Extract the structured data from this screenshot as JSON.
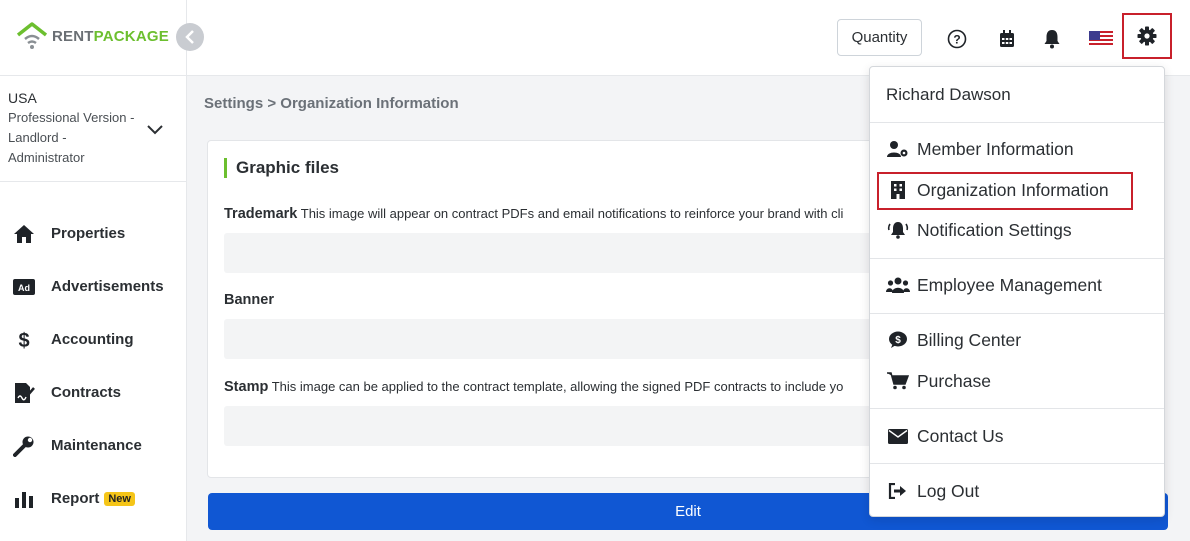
{
  "brand": {
    "name_part1": "RENT",
    "name_part2": "PACKAGE",
    "accent": "#6cbf2f"
  },
  "account": {
    "country": "USA",
    "role": "Professional Version - Landlord - Administrator"
  },
  "nav": [
    {
      "label": "Properties",
      "icon": "home-icon"
    },
    {
      "label": "Advertisements",
      "icon": "ad-icon"
    },
    {
      "label": "Accounting",
      "icon": "dollar-icon"
    },
    {
      "label": "Contracts",
      "icon": "contract-icon"
    },
    {
      "label": "Maintenance",
      "icon": "wrench-icon"
    },
    {
      "label": "Report",
      "icon": "bar-chart-icon",
      "badge": "New"
    }
  ],
  "header": {
    "quantity_label": "Quantity"
  },
  "breadcrumb": {
    "root": "Settings",
    "separator": ">",
    "current": "Organization Information"
  },
  "card": {
    "title": "Graphic files",
    "fields": [
      {
        "label": "Trademark",
        "description": "This image will appear on contract PDFs and email notifications to reinforce your brand with cli"
      },
      {
        "label": "Banner",
        "description": ""
      },
      {
        "label": "Stamp",
        "description": "This image can be applied to the contract template, allowing the signed PDF contracts to include yo"
      }
    ]
  },
  "edit_label": "Edit",
  "dropdown": {
    "user_name": "Richard Dawson",
    "items": [
      {
        "label": "Member Information",
        "icon": "user-gear-icon"
      },
      {
        "label": "Organization Information",
        "icon": "building-icon"
      },
      {
        "label": "Notification Settings",
        "icon": "bell-ring-icon"
      },
      {
        "label": "Employee Management",
        "icon": "users-icon"
      },
      {
        "label": "Billing Center",
        "icon": "dollar-bubble-icon"
      },
      {
        "label": "Purchase",
        "icon": "cart-icon"
      },
      {
        "label": "Contact Us",
        "icon": "envelope-icon"
      },
      {
        "label": "Log Out",
        "icon": "logout-icon"
      }
    ]
  },
  "colors": {
    "primary": "#1057d3",
    "highlight": "#c8202b",
    "badge": "#f5c518"
  }
}
